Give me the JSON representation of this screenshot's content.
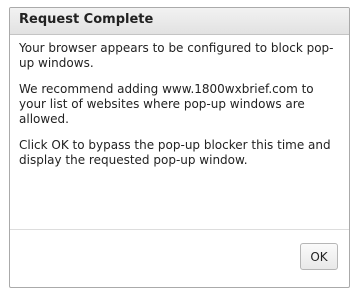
{
  "dialog": {
    "title": "Request Complete",
    "paragraphs": [
      "Your browser appears to be configured to block pop-up windows.",
      "We recommend adding www.1800wxbrief.com to your list of websites where pop-up windows are allowed.",
      "Click OK to bypass the pop-up blocker this time and display the requested pop-up window."
    ],
    "ok_label": "OK"
  }
}
